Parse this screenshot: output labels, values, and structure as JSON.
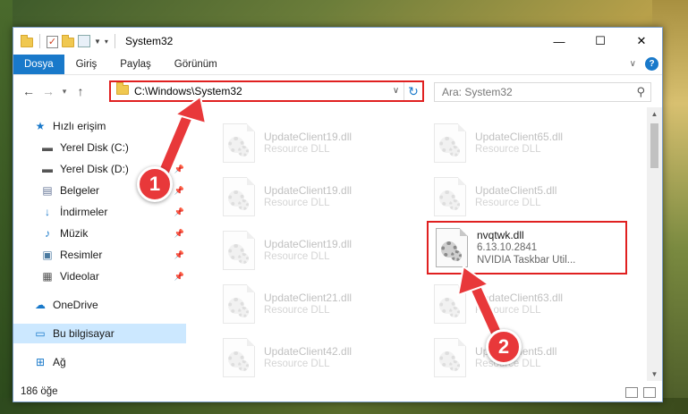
{
  "window": {
    "title": "System32",
    "controls": {
      "minimize": "—",
      "maximize": "☐",
      "close": "✕"
    }
  },
  "ribbon": {
    "tabs": [
      {
        "label": "Dosya"
      },
      {
        "label": "Giriş"
      },
      {
        "label": "Paylaş"
      },
      {
        "label": "Görünüm"
      }
    ],
    "help": "?"
  },
  "nav": {
    "address": "C:\\Windows\\System32",
    "search_placeholder": "Ara: System32"
  },
  "sidebar": {
    "items": [
      {
        "label": "Hızlı erişim",
        "icon": "star-icon"
      },
      {
        "label": "Yerel Disk (C:)",
        "icon": "drive-icon"
      },
      {
        "label": "Yerel Disk (D:)",
        "icon": "drive-icon"
      },
      {
        "label": "Belgeler",
        "icon": "documents-icon"
      },
      {
        "label": "İndirmeler",
        "icon": "download-icon"
      },
      {
        "label": "Müzik",
        "icon": "music-icon"
      },
      {
        "label": "Resimler",
        "icon": "pictures-icon"
      },
      {
        "label": "Videolar",
        "icon": "videos-icon"
      },
      {
        "label": "OneDrive",
        "icon": "cloud-icon"
      },
      {
        "label": "Bu bilgisayar",
        "icon": "computer-icon"
      },
      {
        "label": "Ağ",
        "icon": "network-icon"
      }
    ]
  },
  "files": [
    {
      "name": "UpdateClient19.dll",
      "sub": "Resource DLL"
    },
    {
      "name": "UpdateClient65.dll",
      "sub": "Resource DLL"
    },
    {
      "name": "UpdateClient19.dll",
      "sub": "Resource DLL"
    },
    {
      "name": "UpdateClient5.dll",
      "sub": "Resource DLL"
    },
    {
      "name": "UpdateClient19.dll",
      "sub": "Resource DLL"
    },
    {
      "name": "nvqtwk.dll",
      "sub": "6.13.10.2841",
      "sub2": "NVIDIA Taskbar Util..."
    },
    {
      "name": "UpdateClient21.dll",
      "sub": "Resource DLL"
    },
    {
      "name": "UpdateClient63.dll",
      "sub": "Resource DLL"
    },
    {
      "name": "UpdateClient42.dll",
      "sub": "Resource DLL"
    },
    {
      "name": "UpdateClient5.dll",
      "sub": "Resource DLL"
    }
  ],
  "status": {
    "count": "186 öğe"
  },
  "annotations": {
    "step1": "1",
    "step2": "2"
  },
  "colors": {
    "accent": "#1979ca",
    "highlight": "#e02020",
    "arrow": "#e8383a"
  }
}
